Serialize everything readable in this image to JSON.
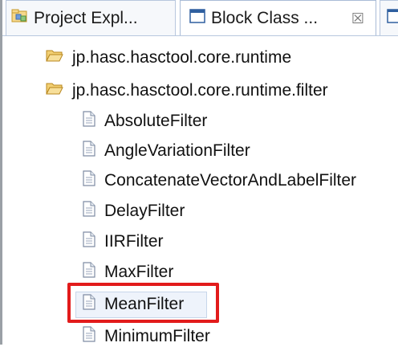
{
  "tabs": [
    {
      "label": "Project Expl...",
      "icon": "project-explorer-icon"
    },
    {
      "label": "Block Class ...",
      "icon": "view-window-icon",
      "close": "☒"
    },
    {
      "label": "",
      "icon": "window-icon"
    }
  ],
  "tree": {
    "packages": [
      {
        "label": "jp.hasc.hasctool.core.runtime",
        "icon": "folder-open-icon"
      },
      {
        "label": "jp.hasc.hasctool.core.runtime.filter",
        "icon": "folder-open-icon"
      }
    ],
    "classes": [
      {
        "label": "AbsoluteFilter"
      },
      {
        "label": "AngleVariationFilter"
      },
      {
        "label": "ConcatenateVectorAndLabelFilter"
      },
      {
        "label": "DelayFilter"
      },
      {
        "label": "IIRFilter"
      },
      {
        "label": "MaxFilter"
      },
      {
        "label": "MeanFilter",
        "selected": true
      },
      {
        "label": "MinimumFilter"
      }
    ]
  },
  "colors": {
    "highlight": "#e21b1b",
    "tab_border": "#b8c7de",
    "folder": "#e3b54c"
  }
}
